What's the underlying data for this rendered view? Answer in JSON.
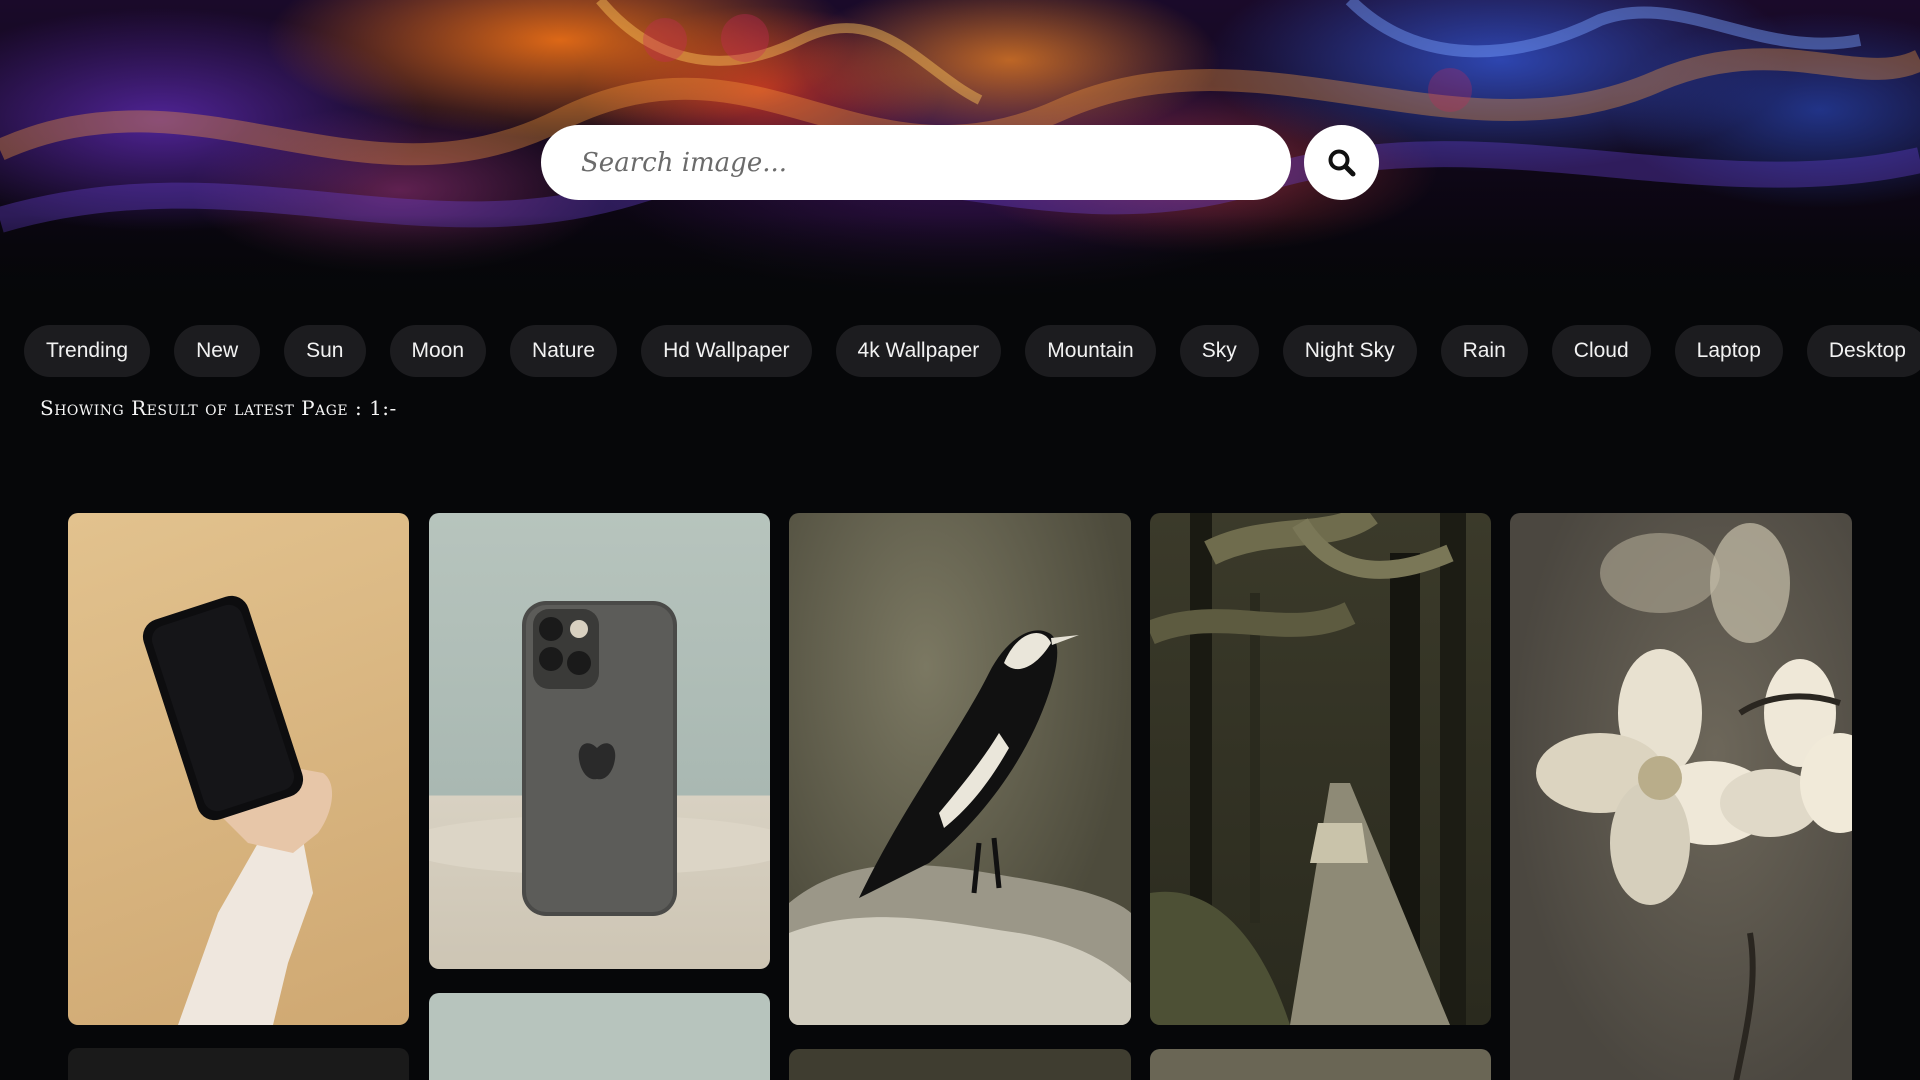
{
  "search": {
    "placeholder": "Search image..."
  },
  "categories": [
    "Trending",
    "New",
    "Sun",
    "Moon",
    "Nature",
    "Hd Wallpaper",
    "4k Wallpaper",
    "Mountain",
    "Sky",
    "Night Sky",
    "Rain",
    "Cloud",
    "Laptop",
    "Desktop"
  ],
  "result_label": "Showing Result of latest Page : 1:-",
  "gallery": {
    "images": [
      {
        "name": "image-hand-holding-phone"
      },
      {
        "name": "image-iphone-back"
      },
      {
        "name": "image-magpie-bird"
      },
      {
        "name": "image-forest-path"
      },
      {
        "name": "image-white-flowers"
      }
    ]
  }
}
